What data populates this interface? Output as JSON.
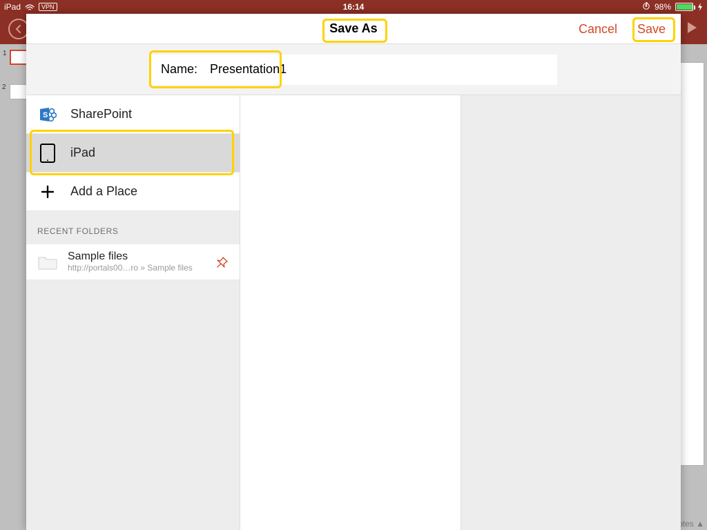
{
  "status": {
    "device": "iPad",
    "vpn": "VPN",
    "time": "16:14",
    "battery_pct": "98%"
  },
  "modal": {
    "title": "Save As",
    "cancel": "Cancel",
    "save": "Save",
    "name_label": "Name:",
    "name_value": "Presentation1",
    "places": [
      {
        "label": "SharePoint"
      },
      {
        "label": "iPad"
      },
      {
        "label": "Add a Place"
      }
    ],
    "recent_header": "RECENT FOLDERS",
    "recent": [
      {
        "title": "Sample files",
        "subtitle": "http://portals00…ro » Sample files"
      }
    ]
  },
  "background": {
    "thumbs": [
      "1",
      "2"
    ],
    "notes_label": "Notes ▲"
  }
}
